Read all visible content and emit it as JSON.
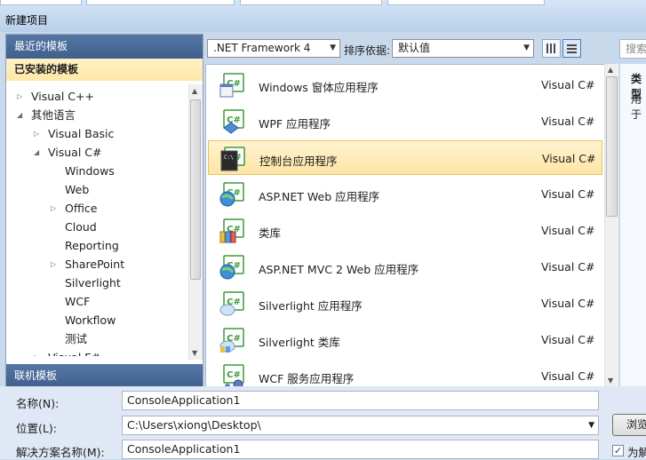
{
  "window": {
    "title": "新建项目"
  },
  "nav": {
    "recent_header": "最近的模板",
    "installed_header": "已安装的模板",
    "online_header": "联机模板",
    "tree": [
      {
        "label": "Visual C++",
        "arrow": "collapsed"
      },
      {
        "label": "其他语言",
        "arrow": "expanded"
      },
      {
        "label": "Visual Basic",
        "arrow": "collapsed"
      },
      {
        "label": "Visual C#",
        "arrow": "expanded"
      },
      {
        "label": "Windows",
        "arrow": "none"
      },
      {
        "label": "Web",
        "arrow": "none"
      },
      {
        "label": "Office",
        "arrow": "collapsed"
      },
      {
        "label": "Cloud",
        "arrow": "none"
      },
      {
        "label": "Reporting",
        "arrow": "none"
      },
      {
        "label": "SharePoint",
        "arrow": "collapsed"
      },
      {
        "label": "Silverlight",
        "arrow": "none"
      },
      {
        "label": "WCF",
        "arrow": "none"
      },
      {
        "label": "Workflow",
        "arrow": "none"
      },
      {
        "label": "测试",
        "arrow": "none"
      },
      {
        "label": "Visual F#",
        "arrow": "collapsed"
      }
    ]
  },
  "toolbar": {
    "framework": ".NET Framework 4",
    "sort_label": "排序依据:",
    "sort_value": "默认值"
  },
  "templates": [
    {
      "name": "Windows 窗体应用程序",
      "lang": "Visual C#",
      "icon": "windows-forms-icon"
    },
    {
      "name": "WPF 应用程序",
      "lang": "Visual C#",
      "icon": "wpf-icon"
    },
    {
      "name": "控制台应用程序",
      "lang": "Visual C#",
      "icon": "console-icon",
      "selected": true
    },
    {
      "name": "ASP.NET Web 应用程序",
      "lang": "Visual C#",
      "icon": "web-globe-icon"
    },
    {
      "name": "类库",
      "lang": "Visual C#",
      "icon": "class-library-icon"
    },
    {
      "name": "ASP.NET MVC 2 Web 应用程序",
      "lang": "Visual C#",
      "icon": "web-globe-icon"
    },
    {
      "name": "Silverlight 应用程序",
      "lang": "Visual C#",
      "icon": "silverlight-icon"
    },
    {
      "name": "Silverlight 类库",
      "lang": "Visual C#",
      "icon": "silverlight-library-icon"
    },
    {
      "name": "WCF 服务应用程序",
      "lang": "Visual C#",
      "icon": "wcf-icon"
    }
  ],
  "right": {
    "search_placeholder": "搜索",
    "type_label": "类型",
    "desc_label": "用于"
  },
  "form": {
    "name_label": "名称(N):",
    "name_value": "ConsoleApplication1",
    "location_label": "位置(L):",
    "location_value": "C:\\Users\\xiong\\Desktop\\",
    "solution_label": "解决方案名称(M):",
    "solution_value": "ConsoleApplication1",
    "browse_label": "浏览",
    "checkbox_label": "为解"
  },
  "colors": {
    "nav_header": "#4a6b98",
    "selection": "#fde9b0",
    "csharp_green": "#3c9a3c"
  }
}
